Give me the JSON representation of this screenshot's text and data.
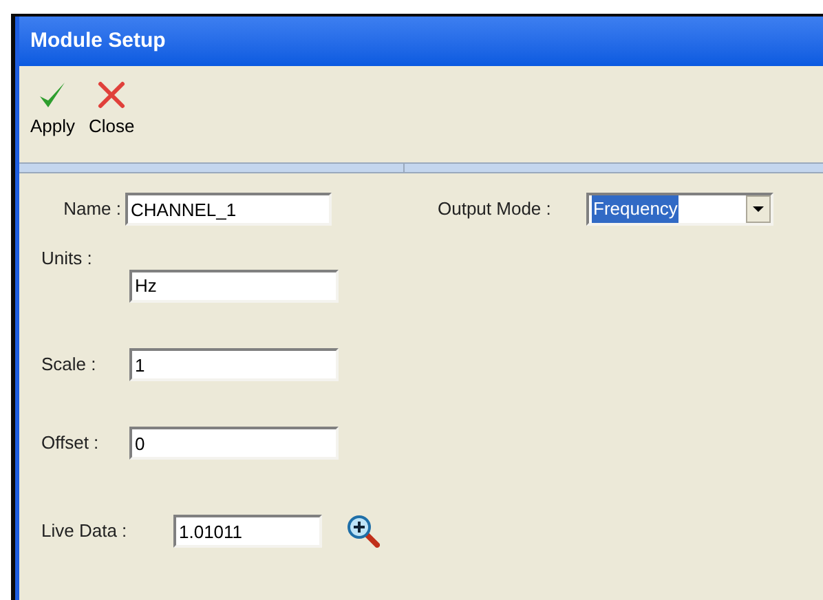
{
  "window": {
    "title": "Module Setup"
  },
  "toolbar": [
    {
      "kind": "apply",
      "label": "Apply"
    },
    {
      "kind": "close",
      "label": "Close"
    }
  ],
  "fields": [
    {
      "label": "Name :",
      "value": "CHANNEL_1"
    },
    {
      "label": "Units :",
      "value": "Hz"
    },
    {
      "label": "Scale :",
      "value": "1"
    },
    {
      "label": "Offset :",
      "value": "0"
    }
  ],
  "live_data": {
    "label": "Live Data :",
    "value": "1.01011"
  },
  "output_mode": {
    "label": "Output Mode :",
    "value": "Frequency"
  }
}
